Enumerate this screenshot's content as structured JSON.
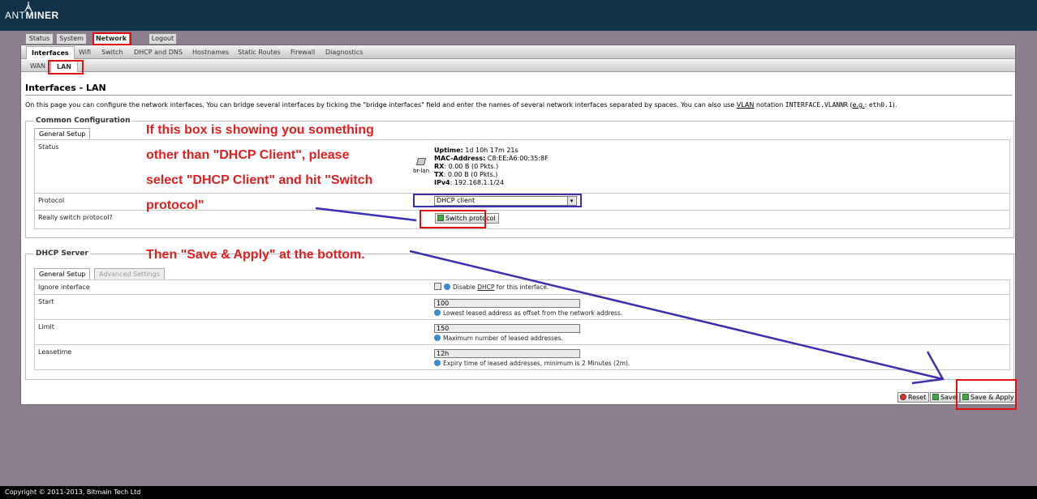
{
  "header": {
    "logo_prefix": "ANT",
    "logo_suffix": "MINER"
  },
  "main_tabs": {
    "status": "Status",
    "system": "System",
    "network": "Network",
    "logout": "Logout"
  },
  "sub_tabs": {
    "interfaces": "Interfaces",
    "wifi": "Wifi",
    "switch": "Switch",
    "dhcp_dns": "DHCP and DNS",
    "hostnames": "Hostnames",
    "static_routes": "Static Routes",
    "firewall": "Firewall",
    "diagnostics": "Diagnostics"
  },
  "iface_tabs": {
    "wan": "WAN",
    "lan": "LAN"
  },
  "page": {
    "title": "Interfaces - LAN",
    "desc_1": "On this page you can configure the network interfaces. You can bridge several interfaces by ticking the \"bridge interfaces\" field and enter the names of several network interfaces separated by spaces. You can also use ",
    "desc_vlan": "VLAN",
    "desc_2": " notation ",
    "desc_code": "INTERFACE.VLANNR",
    "desc_3": " (",
    "desc_eg": "e.g.",
    "desc_4": ": ",
    "desc_code2": "eth0.1",
    "desc_5": ")."
  },
  "common": {
    "legend": "Common Configuration",
    "tab_general": "General Setup",
    "status_label": "Status",
    "iface_name": "br-lan",
    "uptime_k": "Uptime:",
    "uptime_v": " 1d 10h 17m 21s",
    "mac_k": "MAC-Address:",
    "mac_v": " C8:EE:A6:00:35:8F",
    "rx_k": "RX",
    "rx_v": ": 0.00 B (0 Pkts.)",
    "tx_k": "TX",
    "tx_v": ": 0.00 B (0 Pkts.)",
    "ipv4_k": "IPv4",
    "ipv4_v": ": 192.168.1.1/24",
    "protocol_label": "Protocol",
    "protocol_value": "DHCP client",
    "switch_label": "Really switch protocol?",
    "switch_button": "Switch protocol"
  },
  "dhcp": {
    "legend": "DHCP Server",
    "tab_general": "General Setup",
    "tab_advanced": "Advanced Settings",
    "ignore_label": "Ignore interface",
    "ignore_hint_1": "Disable ",
    "ignore_hint_dhcp": "DHCP",
    "ignore_hint_2": " for this interface.",
    "start_label": "Start",
    "start_value": "100",
    "start_hint": "Lowest leased address as offset from the network address.",
    "limit_label": "Limit",
    "limit_value": "150",
    "limit_hint": "Maximum number of leased addresses.",
    "lease_label": "Leasetime",
    "lease_value": "12h",
    "lease_hint": "Expiry time of leased addresses, minimum is 2 Minutes (2m)."
  },
  "actions": {
    "reset": "Reset",
    "save": "Save",
    "save_apply": "Save & Apply"
  },
  "annotations": {
    "line1": "If this box is showing you something",
    "line2": "other than \"DHCP Client\", please",
    "line3": "select \"DHCP Client\" and hit \"Switch",
    "line4": "protocol\"",
    "line5": "Then \"Save & Apply\" at the bottom."
  },
  "footer": {
    "copyright": "Copyright © 2011-2013, Bitmain Tech Ltd"
  },
  "colors": {
    "header": "#143247",
    "background": "#8d7f8f",
    "annotation_red": "#e02020",
    "annotation_blue": "#3a2fb0"
  }
}
